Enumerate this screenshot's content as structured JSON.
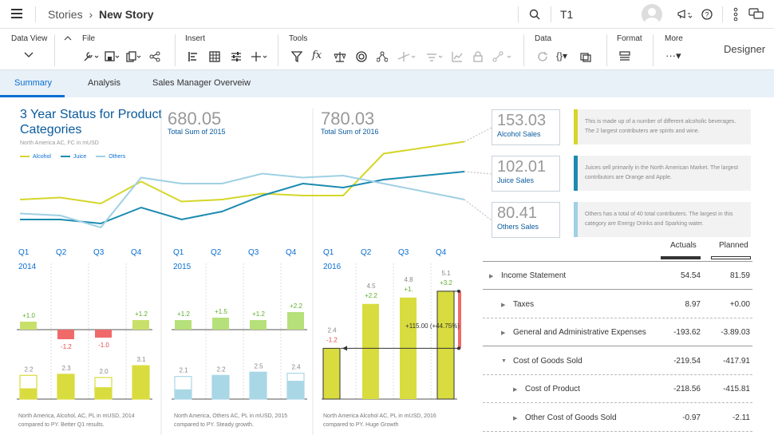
{
  "app": {
    "breadcrumb_root": "Stories",
    "breadcrumb_sep": "›",
    "breadcrumb_current": "New Story",
    "tab_field": "T1"
  },
  "toolbar": {
    "data_view": "Data View",
    "file": "File",
    "insert": "Insert",
    "tools": "Tools",
    "data": "Data",
    "format": "Format",
    "more": "More",
    "designer": "Designer"
  },
  "tabs": [
    "Summary",
    "Analysis",
    "Sales Manager Overveiw"
  ],
  "title": "3 Year Status for Product Categories",
  "subtitle": "North America AC, FC in mUSD",
  "legend": [
    {
      "name": "Alcohol",
      "color": "#d4d62a"
    },
    {
      "name": "Juice",
      "color": "#1b8bb0"
    },
    {
      "name": "Others",
      "color": "#9fd0e3"
    }
  ],
  "kpis": [
    {
      "value": "680.05",
      "label": "Total Sum of 2015"
    },
    {
      "value": "780.03",
      "label": "Total Sum of 2016"
    }
  ],
  "sales": [
    {
      "value": "153.03",
      "label": "Alcohol Sales"
    },
    {
      "value": "102.01",
      "label": "Juice Sales"
    },
    {
      "value": "80.41",
      "label": "Others Sales"
    }
  ],
  "notes": [
    "This is made up of a number of different alcoholic beverages. The 2 largest contributers are spirits and wine.",
    "Juices sell primarily in the North American Market. The largest contributors are Orange and Apple.",
    "Others has a total of 40 total contributers. The largest  in this category are Energy Drinks and Sparking water."
  ],
  "chart_data": [
    {
      "type": "line",
      "x": [
        "2014 Q1",
        "Q2",
        "Q3",
        "Q4",
        "2015 Q1",
        "Q2",
        "Q3",
        "Q4",
        "2016 Q1",
        "Q2",
        "Q3",
        "Q4"
      ],
      "series": [
        {
          "name": "Alcohol",
          "values": [
            2.2,
            2.3,
            2.0,
            3.1,
            2.1,
            2.2,
            2.5,
            2.4,
            2.4,
            4.5,
            4.8,
            5.1
          ]
        },
        {
          "name": "Juice",
          "values": [
            1.2,
            1.2,
            1.0,
            1.8,
            1.2,
            1.6,
            2.4,
            3.0,
            2.8,
            3.2,
            3.4,
            3.6
          ]
        },
        {
          "name": "Others",
          "values": [
            1.5,
            1.4,
            0.8,
            3.3,
            3.0,
            3.0,
            3.5,
            3.3,
            3.4,
            3.0,
            2.6,
            2.2
          ]
        }
      ]
    },
    {
      "type": "bar",
      "title": "2014",
      "categories": [
        "Q1",
        "Q2",
        "Q3",
        "Q4"
      ],
      "variance": [
        "+1.0",
        "-1.2",
        "-1.0",
        "+1.2"
      ],
      "variance_values": [
        1.0,
        -1.2,
        -1.0,
        1.2
      ],
      "labels": [
        "",
        "2.2",
        "2.3",
        "2.0",
        "3.1"
      ],
      "actual": [
        1.0,
        2.3,
        1.1,
        3.1
      ],
      "previous": [
        2.2,
        2.3,
        2.0,
        3.1
      ],
      "footnote": "North America, Alcohol, AC, PL in mUSD, 2014 compared to PY. Better Q1 results."
    },
    {
      "type": "bar",
      "title": "2015",
      "categories": [
        "Q1",
        "Q2",
        "Q3",
        "Q4"
      ],
      "variance": [
        "+1.2",
        "+1.5",
        "+1.2",
        "+2.2"
      ],
      "variance_values": [
        1.2,
        1.5,
        1.2,
        2.2
      ],
      "labels": [
        "2.1",
        "2.2",
        "2.5",
        "2.4"
      ],
      "actual": [
        0.9,
        2.2,
        2.5,
        1.7
      ],
      "previous": [
        2.1,
        2.2,
        2.5,
        2.4
      ],
      "footnote": "North America, Others AC, PL in mUSD, 2015 compared to PY. Steady growth."
    },
    {
      "type": "bar",
      "title": "2016",
      "categories": [
        "Q1",
        "Q2",
        "Q3",
        "Q4"
      ],
      "values": [
        2.4,
        4.5,
        4.8,
        5.1
      ],
      "variance": [
        "-1.2",
        "+2.2",
        "+1.",
        "+3.2"
      ],
      "annotation": "+115.00 (+44.75%)",
      "footnote": "North America Alcohol AC, PL in mUSD, 2016 compared to PY. Huge Growth"
    }
  ],
  "table": {
    "headers": [
      "Actuals",
      "Planned"
    ],
    "rows": [
      {
        "label": "Income Statement",
        "actual": "54.54",
        "planned": "81.59",
        "arrow": "right",
        "indent": 0
      },
      {
        "label": "Taxes",
        "actual": "8.97",
        "planned": "+0.00",
        "arrow": "right",
        "indent": 1
      },
      {
        "label": "General and Administrative Expenses",
        "actual": "-193.62",
        "planned": "-3.89.03",
        "arrow": "right",
        "indent": 1
      },
      {
        "label": "Cost of Goods Sold",
        "actual": "-219.54",
        "planned": "-417.91",
        "arrow": "down",
        "indent": 1
      },
      {
        "label": "Cost of Product",
        "actual": "-218.56",
        "planned": "-415.81",
        "arrow": "right",
        "indent": 2
      },
      {
        "label": "Other Cost of Goods Sold",
        "actual": "-0.97",
        "planned": "-2.11",
        "arrow": "right",
        "indent": 2
      }
    ]
  }
}
